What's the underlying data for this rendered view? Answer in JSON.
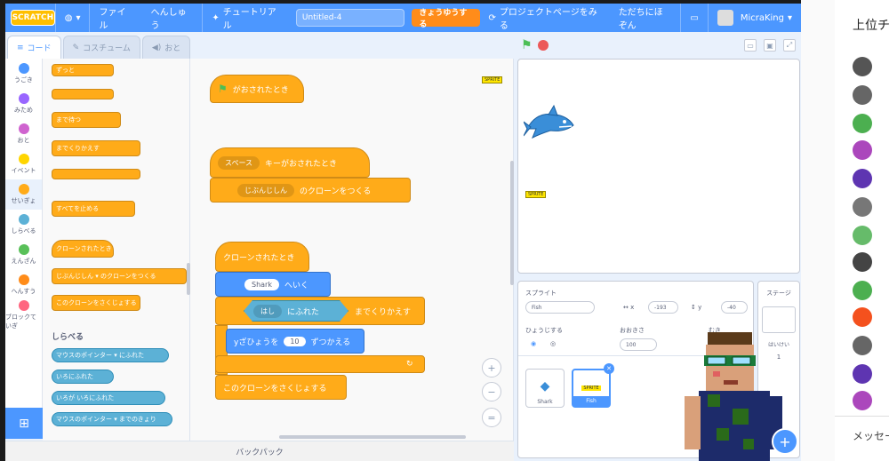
{
  "menubar": {
    "logo": "SCRATCH",
    "file": "ファイル",
    "edit": "へんしゅう",
    "tutorial": "チュートリアル",
    "project_title": "Untitled-4",
    "share": "きょうゆうする",
    "project_page": "プロジェクトページをみる",
    "save_now": "ただちにほぞん",
    "username": "MicraKing"
  },
  "tabs": {
    "code": "コード",
    "costume": "コスチューム",
    "sound": "おと"
  },
  "categories": [
    {
      "label": "うごき",
      "color": "#4c97ff"
    },
    {
      "label": "みため",
      "color": "#9966ff"
    },
    {
      "label": "おと",
      "color": "#cf63cf"
    },
    {
      "label": "イベント",
      "color": "#ffd500"
    },
    {
      "label": "せいぎょ",
      "color": "#ffab19"
    },
    {
      "label": "しらべる",
      "color": "#5cb1d6"
    },
    {
      "label": "えんざん",
      "color": "#59c059"
    },
    {
      "label": "へんすう",
      "color": "#ff8c1a"
    },
    {
      "label": "ブロックていぎ",
      "color": "#ff6680"
    }
  ],
  "palette": {
    "blk1": "ずっと",
    "blk2": "まで待つ",
    "blk3": "までくりかえす",
    "blk4": "すべてを止める",
    "blk5": "クローンされたとき",
    "blk6": "じぶんじしん ▾ のクローンをつくる",
    "blk7": "このクローンをさくじょする",
    "sensing_header": "しらべる",
    "s1": "マウスのポインター ▾ にふれた",
    "s2": "いろにふれた",
    "s3": "いろが  いろにふれた",
    "s4": "マウスのポインター ▾ までのきょり"
  },
  "script": {
    "flag_hat": "がおされたとき",
    "key_hat_key": "スペース",
    "key_hat_text": "キーがおされたとき",
    "clone_menu": "じぶんじしん",
    "clone_text": "のクローンをつくる",
    "clone_hat": "クローンされたとき",
    "goto_menu": "Shark",
    "goto_text": "へいく",
    "touch_menu": "はし",
    "touch_text": "にふれた",
    "repeat_until": "までくりかえす",
    "change_y_text": "yざひょうを",
    "change_y_value": "10",
    "change_y_suffix": "ずつかえる",
    "delete_clone": "このクローンをさくじょする",
    "tag": "SPRITE"
  },
  "backpack": "バックパック",
  "sprite_info": {
    "sprite_label": "スプライト",
    "sprite_name": "Fish",
    "x_label": "x",
    "x_value": "-193",
    "y_label": "y",
    "y_value": "-40",
    "show_label": "ひょうじする",
    "size_label": "おおきさ",
    "size_value": "100",
    "direction_label": "むき",
    "direction_value": "90"
  },
  "sprites": [
    {
      "name": "Shark"
    },
    {
      "name": "Fish"
    }
  ],
  "stage_pane": {
    "label": "ステージ",
    "backdrops_label": "はいけい",
    "backdrops_count": "1"
  },
  "side_panel": {
    "title": "上位チャット",
    "message_placeholder": "メッセージ..."
  },
  "colors": {
    "menubar": "#4c97ff",
    "control": "#ffab19",
    "motion": "#4c97ff",
    "sensing": "#5cb1d6"
  }
}
